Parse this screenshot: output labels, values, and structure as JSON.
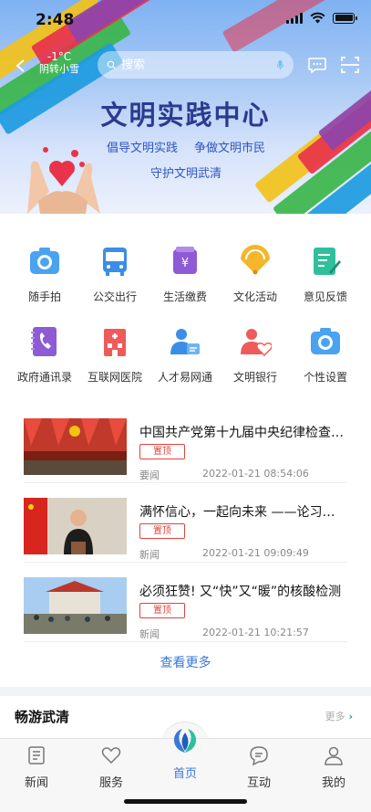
{
  "status_bar": {
    "time": "2:48"
  },
  "header": {
    "weather_temp": "-1°C",
    "weather_desc": "阴转小雪",
    "search_placeholder": "搜索"
  },
  "banner": {
    "title": "文明实践中心",
    "slogan_1": "倡导文明实践",
    "slogan_2": "争做文明市民",
    "slogan_3": "守护文明武清"
  },
  "services": [
    {
      "label": "随手拍",
      "icon": "camera-icon"
    },
    {
      "label": "公交出行",
      "icon": "bus-icon"
    },
    {
      "label": "生活缴费",
      "icon": "payment-icon"
    },
    {
      "label": "文化活动",
      "icon": "fan-icon"
    },
    {
      "label": "意见反馈",
      "icon": "feedback-icon"
    },
    {
      "label": "政府通讯录",
      "icon": "phonebook-icon"
    },
    {
      "label": "互联网医院",
      "icon": "hospital-icon"
    },
    {
      "label": "人才易网通",
      "icon": "talent-icon"
    },
    {
      "label": "文明银行",
      "icon": "civility-bank-icon"
    },
    {
      "label": "个性设置",
      "icon": "settings-camera-icon"
    }
  ],
  "news": [
    {
      "title": "中国共产党第十九届中央纪律检查委员会",
      "badge": "置顶",
      "category": "要闻",
      "date": "2022-01-21 08:54:06"
    },
    {
      "title": "满怀信心，一起向未来 ——论习近平主席",
      "badge": "置顶",
      "category": "新闻",
      "date": "2022-01-21 09:09:49"
    },
    {
      "title": "必须狂赞! 又“快”又“暖”的核酸检测",
      "badge": "置顶",
      "category": "新闻",
      "date": "2022-01-21 10:21:57"
    }
  ],
  "news_more": "查看更多",
  "tour": {
    "title": "畅游武清",
    "more": "更多"
  },
  "tabs": [
    {
      "label": "新闻"
    },
    {
      "label": "服务"
    },
    {
      "label": "首页"
    },
    {
      "label": "互动"
    },
    {
      "label": "我的"
    }
  ],
  "colors": {
    "accent": "#3b78d8",
    "pin_red": "#e2433b",
    "banner_title": "#2a3b8f"
  }
}
